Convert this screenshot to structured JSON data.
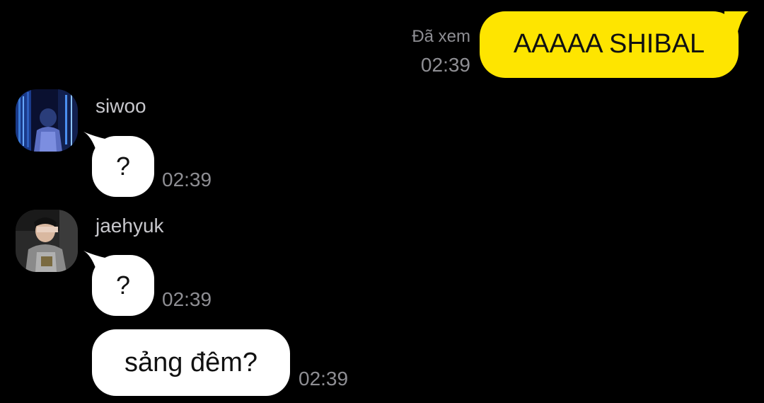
{
  "colors": {
    "background": "#000000",
    "outgoing_bubble": "#FEE500",
    "incoming_bubble": "#FFFFFF",
    "meta_text": "#8E8E93",
    "sender_name": "#C7C7CC"
  },
  "outgoing": {
    "status": "Đã xem",
    "time": "02:39",
    "text": "AAAAA SHIBAL"
  },
  "messages": [
    {
      "sender": "siwoo",
      "avatar_icon": "photo-avatar-blue",
      "text": "?",
      "time": "02:39"
    },
    {
      "sender": "jaehyuk",
      "avatar_icon": "photo-avatar-dark",
      "text": "?",
      "time": "02:39"
    },
    {
      "text": "sảng đêm?",
      "time": "02:39"
    }
  ]
}
